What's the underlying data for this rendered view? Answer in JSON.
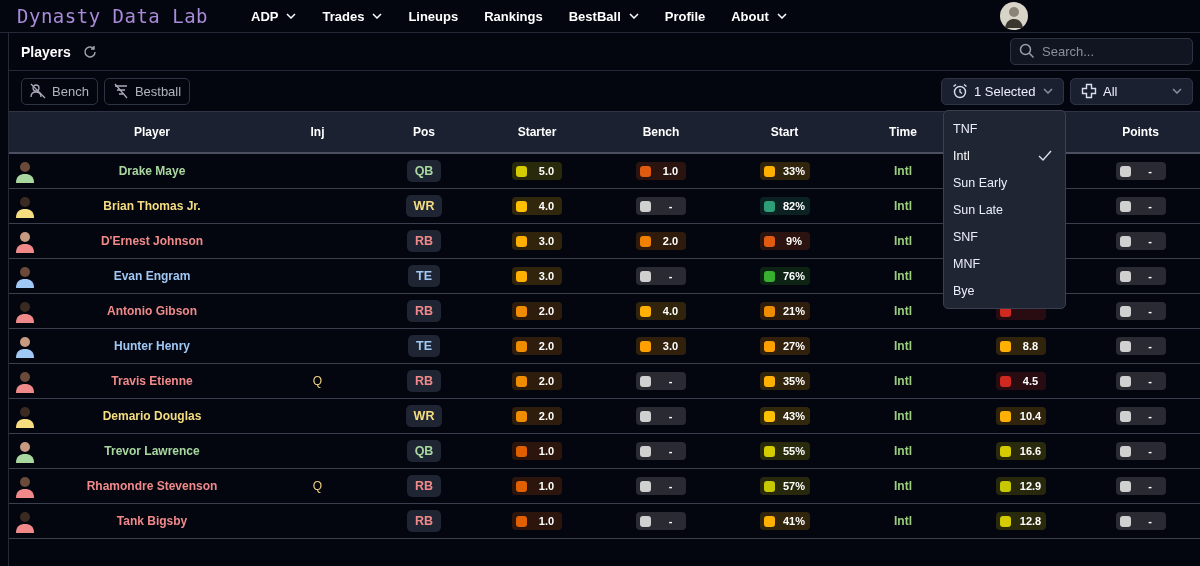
{
  "nav": {
    "logo": "Dynasty Data Lab",
    "items": [
      {
        "label": "ADP",
        "dropdown": true
      },
      {
        "label": "Trades",
        "dropdown": true
      },
      {
        "label": "Lineups",
        "dropdown": false
      },
      {
        "label": "Rankings",
        "dropdown": false
      },
      {
        "label": "BestBall",
        "dropdown": true
      },
      {
        "label": "Profile",
        "dropdown": false
      },
      {
        "label": "About",
        "dropdown": true
      }
    ]
  },
  "header": {
    "title": "Players",
    "search": {
      "placeholder": "Search..."
    }
  },
  "toolbar": {
    "filters": [
      "Bench",
      "Bestball"
    ],
    "time_select": "1 Selected",
    "position_select": "All"
  },
  "table": {
    "columns": [
      "Player",
      "Inj",
      "Pos",
      "Starter",
      "Bench",
      "Start",
      "Time",
      "Points"
    ],
    "rows": [
      {
        "name": "Drake Maye",
        "color": "#a8d8a0",
        "pos": "QB",
        "starter": {
          "value": "5.0",
          "color": "#d4cc00"
        },
        "bench": {
          "value": "1.0",
          "color": "#e05a10"
        },
        "start": {
          "value": "33%",
          "color": "#ffb000"
        },
        "time": "Intl",
        "points": {
          "value": "-",
          "color": "#d0d0d0"
        }
      },
      {
        "name": "Brian Thomas Jr.",
        "color": "#f5dd80",
        "pos": "WR",
        "starter": {
          "value": "4.0",
          "color": "#ffc000"
        },
        "bench": {
          "value": "-",
          "color": "#d0d0d0"
        },
        "start": {
          "value": "82%",
          "color": "#2e9e78"
        },
        "time": "Intl",
        "points": {
          "value": "-",
          "color": "#d0d0d0"
        }
      },
      {
        "name": "D'Ernest Johnson",
        "color": "#f08a8a",
        "pos": "RB",
        "starter": {
          "value": "3.0",
          "color": "#ffb000"
        },
        "bench": {
          "value": "2.0",
          "color": "#f08000"
        },
        "start": {
          "value": "9%",
          "color": "#e05a10"
        },
        "time": "Intl",
        "points": {
          "value": "-",
          "color": "#d0d0d0"
        }
      },
      {
        "name": "Evan Engram",
        "color": "#a0c8f5",
        "pos": "TE",
        "starter": {
          "value": "3.0",
          "color": "#ffb000"
        },
        "bench": {
          "value": "-",
          "color": "#d0d0d0"
        },
        "start": {
          "value": "76%",
          "color": "#38b030"
        },
        "time": "Intl",
        "points": {
          "value": "-",
          "color": "#d0d0d0"
        }
      },
      {
        "name": "Antonio Gibson",
        "color": "#f08a8a",
        "pos": "RB",
        "starter": {
          "value": "2.0",
          "color": "#f08c00"
        },
        "bench": {
          "value": "4.0",
          "color": "#ffb000"
        },
        "start": {
          "value": "21%",
          "color": "#f08c00"
        },
        "time": "Intl",
        "column_8": {
          "color": "#d02a20"
        },
        "points": {
          "value": "-",
          "color": "#d0d0d0"
        }
      },
      {
        "name": "Hunter Henry",
        "color": "#a0c8f5",
        "pos": "TE",
        "starter": {
          "value": "2.0",
          "color": "#f08c00"
        },
        "bench": {
          "value": "3.0",
          "color": "#ffa000"
        },
        "start": {
          "value": "27%",
          "color": "#ffa000"
        },
        "time": "Intl",
        "column_8": {
          "value": "8.8",
          "color": "#ffb000"
        },
        "points": {
          "value": "-",
          "color": "#d0d0d0"
        }
      },
      {
        "name": "Travis Etienne",
        "color": "#f08a8a",
        "injury": "Q",
        "pos": "RB",
        "starter": {
          "value": "2.0",
          "color": "#f08c00"
        },
        "bench": {
          "value": "-",
          "color": "#d0d0d0"
        },
        "start": {
          "value": "35%",
          "color": "#ffb000"
        },
        "time": "Intl",
        "column_8": {
          "value": "4.5",
          "color": "#d02a20"
        },
        "points": {
          "value": "-",
          "color": "#d0d0d0"
        }
      },
      {
        "name": "Demario Douglas",
        "color": "#f5dd80",
        "pos": "WR",
        "starter": {
          "value": "2.0",
          "color": "#f08c00"
        },
        "bench": {
          "value": "-",
          "color": "#d0d0d0"
        },
        "start": {
          "value": "43%",
          "color": "#ffc000"
        },
        "time": "Intl",
        "column_8": {
          "value": "10.4",
          "color": "#ffb000"
        },
        "points": {
          "value": "-",
          "color": "#d0d0d0"
        }
      },
      {
        "name": "Trevor Lawrence",
        "color": "#a8d8a0",
        "pos": "QB",
        "starter": {
          "value": "1.0",
          "color": "#e06000"
        },
        "bench": {
          "value": "-",
          "color": "#d0d0d0"
        },
        "start": {
          "value": "55%",
          "color": "#d4cc00"
        },
        "time": "Intl",
        "column_8": {
          "value": "16.6",
          "color": "#d4cc00"
        },
        "points": {
          "value": "-",
          "color": "#d0d0d0"
        }
      },
      {
        "name": "Rhamondre Stevenson",
        "color": "#f08a8a",
        "injury": "Q",
        "pos": "RB",
        "starter": {
          "value": "1.0",
          "color": "#e06000"
        },
        "bench": {
          "value": "-",
          "color": "#d0d0d0"
        },
        "start": {
          "value": "57%",
          "color": "#c8c800"
        },
        "time": "Intl",
        "column_8": {
          "value": "12.9",
          "color": "#c8c800"
        },
        "points": {
          "value": "-",
          "color": "#d0d0d0"
        }
      },
      {
        "name": "Tank Bigsby",
        "color": "#f08a8a",
        "pos": "RB",
        "starter": {
          "value": "1.0",
          "color": "#e06000"
        },
        "bench": {
          "value": "-",
          "color": "#d0d0d0"
        },
        "start": {
          "value": "41%",
          "color": "#ffb000"
        },
        "time": "Intl",
        "column_8": {
          "value": "12.8",
          "color": "#d4cc00"
        },
        "points": {
          "value": "-",
          "color": "#d0d0d0"
        }
      }
    ]
  },
  "time_dropdown": {
    "options": [
      {
        "label": "TNF",
        "selected": false
      },
      {
        "label": "Intl",
        "selected": true
      },
      {
        "label": "Sun Early",
        "selected": false
      },
      {
        "label": "Sun Late",
        "selected": false
      },
      {
        "label": "SNF",
        "selected": false
      },
      {
        "label": "MNF",
        "selected": false
      },
      {
        "label": "Bye",
        "selected": false
      }
    ]
  }
}
